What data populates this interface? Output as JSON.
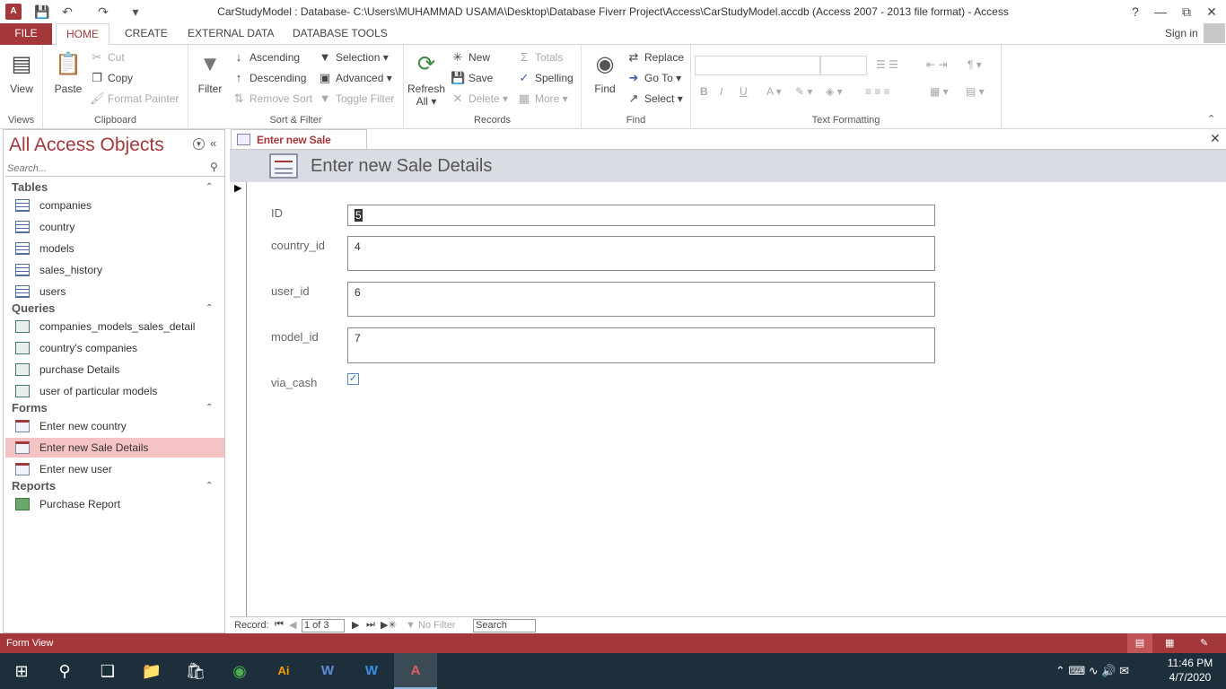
{
  "window": {
    "title": "CarStudyModel : Database- C:\\Users\\MUHAMMAD USAMA\\Desktop\\Database Fiverr Project\\Access\\CarStudyModel.accdb (Access 2007 - 2013 file format) - Access",
    "help": "?",
    "sign_in": "Sign in"
  },
  "tabs": [
    "FILE",
    "HOME",
    "CREATE",
    "EXTERNAL DATA",
    "DATABASE TOOLS"
  ],
  "ribbon": {
    "views": {
      "view": "View",
      "label": "Views"
    },
    "clipboard": {
      "paste": "Paste",
      "cut": "Cut",
      "copy": "Copy",
      "format_painter": "Format Painter",
      "label": "Clipboard"
    },
    "sort_filter": {
      "filter": "Filter",
      "ascending": "Ascending",
      "descending": "Descending",
      "remove_sort": "Remove Sort",
      "selection": "Selection",
      "advanced": "Advanced",
      "toggle_filter": "Toggle Filter",
      "label": "Sort & Filter"
    },
    "records": {
      "refresh": "Refresh",
      "refresh2": "All",
      "new": "New",
      "save": "Save",
      "delete": "Delete",
      "totals": "Totals",
      "spelling": "Spelling",
      "more": "More",
      "label": "Records"
    },
    "find": {
      "find": "Find",
      "replace": "Replace",
      "goto": "Go To",
      "select": "Select",
      "label": "Find"
    },
    "text_formatting": {
      "bold": "B",
      "italic": "I",
      "underline": "U",
      "font_color": "A",
      "label": "Text Formatting"
    }
  },
  "nav": {
    "title": "All Access Objects",
    "search_placeholder": "Search...",
    "sections": [
      {
        "name": "Tables",
        "items": [
          "companies",
          "country",
          "models",
          "sales_history",
          "users"
        ]
      },
      {
        "name": "Queries",
        "items": [
          "companies_models_sales_detail",
          "country's companies",
          "purchase Details",
          "user of particular models"
        ]
      },
      {
        "name": "Forms",
        "items": [
          "Enter new country",
          "Enter new Sale Details",
          "Enter new user"
        ]
      },
      {
        "name": "Reports",
        "items": [
          "Purchase Report"
        ]
      }
    ],
    "selected": "Enter new Sale Details"
  },
  "document": {
    "tab_label": "Enter new Sale Details",
    "form_title": "Enter new Sale Details",
    "fields": [
      {
        "label": "ID",
        "value": "5"
      },
      {
        "label": "country_id",
        "value": "4"
      },
      {
        "label": "user_id",
        "value": "6"
      },
      {
        "label": "model_id",
        "value": "7"
      }
    ],
    "checkbox": {
      "label": "via_cash",
      "checked": true
    }
  },
  "record_nav": {
    "label": "Record:",
    "position": "1 of 3",
    "filter": "No Filter",
    "search": "Search"
  },
  "status": {
    "text": "Form View"
  },
  "taskbar": {
    "time": "11:46 PM",
    "date": "4/7/2020"
  },
  "colors": {
    "accent": "#a4373a",
    "selected": "#f6c3c4",
    "form_header": "#d9dde3",
    "taskbar": "#1d2f3a"
  }
}
